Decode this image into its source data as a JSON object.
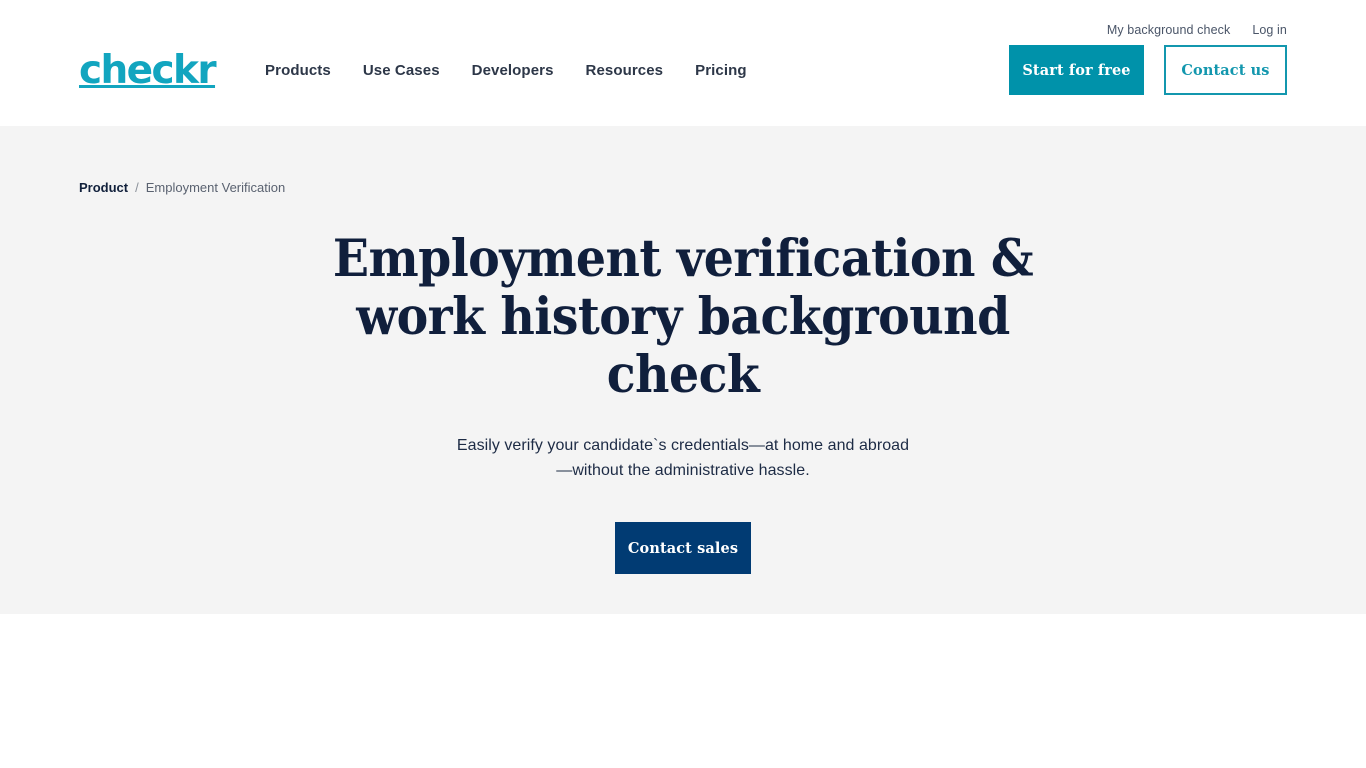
{
  "header": {
    "logo_text": "checkr",
    "utility_links": [
      {
        "label": "My background check"
      },
      {
        "label": "Log in"
      }
    ],
    "nav_items": [
      {
        "label": "Products"
      },
      {
        "label": "Use Cases"
      },
      {
        "label": "Developers"
      },
      {
        "label": "Resources"
      },
      {
        "label": "Pricing"
      }
    ],
    "start_for_free_label": "Start for free",
    "contact_us_label": "Contact us"
  },
  "hero": {
    "breadcrumb": {
      "parent_label": "Product",
      "separator": "/",
      "current_label": "Employment Verification"
    },
    "title": "Employment verification & work history background check",
    "subtitle": "Easily verify your candidate`s credentials—at home and abroad—without the administrative hassle.",
    "cta_label": "Contact sales"
  },
  "colors": {
    "brand_teal": "#12a5bf",
    "button_teal": "#0092aa",
    "outline_teal": "#1397ae",
    "navy": "#101f3c",
    "cta_navy": "#013b73",
    "hero_background": "#f4f4f4",
    "page_background": "#ffffff"
  }
}
